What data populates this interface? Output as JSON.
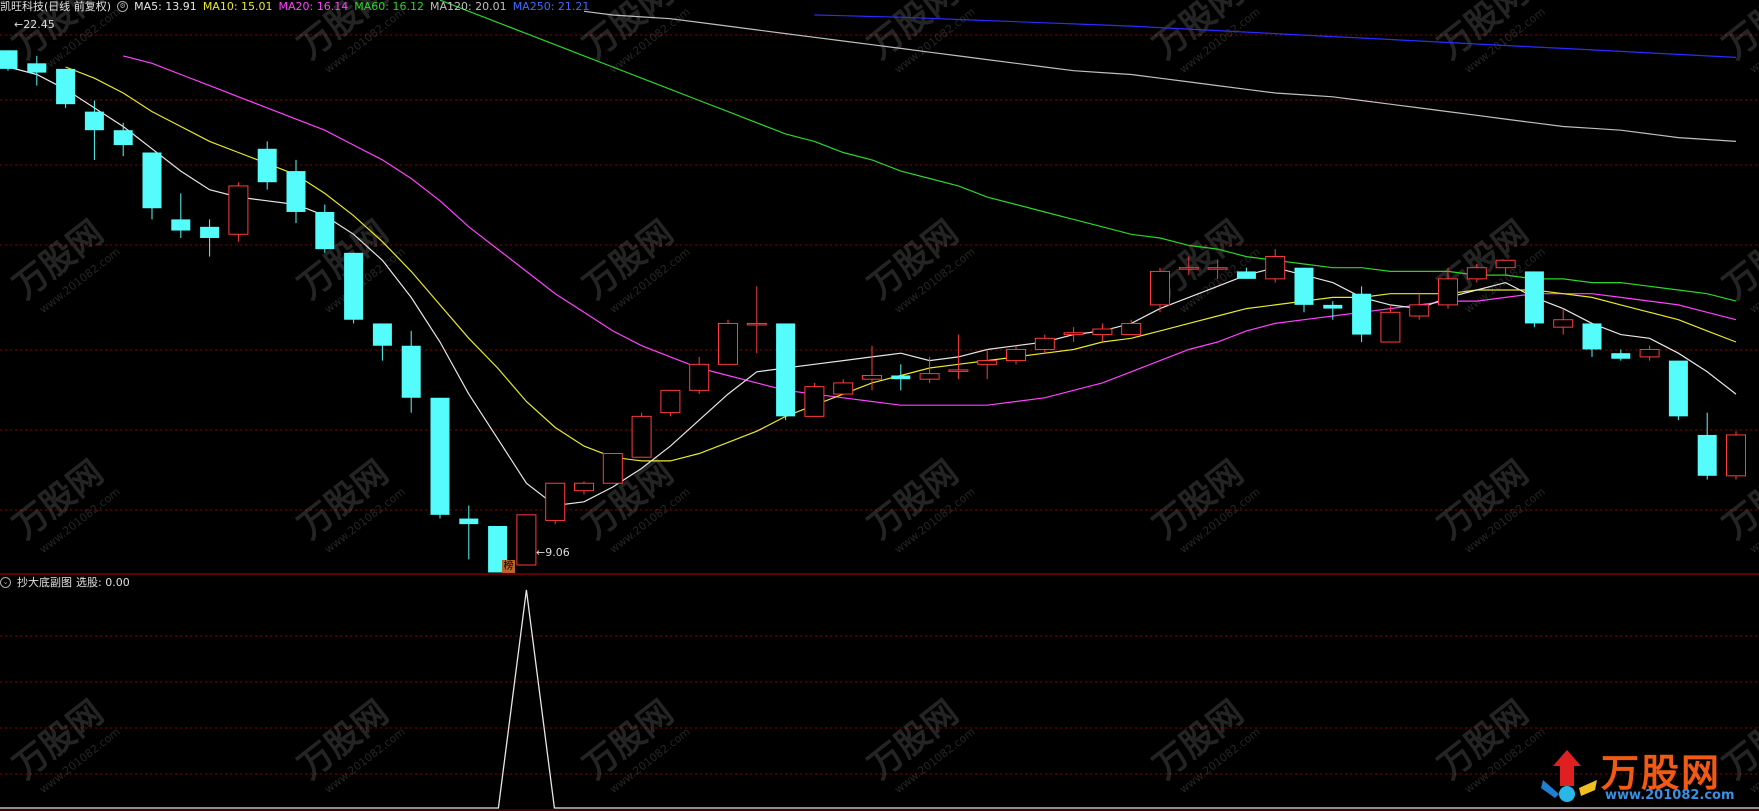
{
  "main_header": {
    "stock_title": "凯旺科技(日线 前复权)",
    "ma5_label": "MA5: 13.91",
    "ma10_label": "MA10: 15.01",
    "ma20_label": "MA20: 16.14",
    "ma60_label": "MA60: 16.12",
    "ma120_label": "MA120: 20.01",
    "ma250_label": "MA250: 21.21"
  },
  "sub_header": {
    "indicator_name": "抄大底副图",
    "pick_label": "选股: 0.00"
  },
  "annotations": {
    "high_price_label": "22.45",
    "low_price_label": "9.06",
    "badge_label": "榜"
  },
  "watermark": {
    "site": "万股网",
    "url": "www.201082.com"
  },
  "colors": {
    "up": "#ff3b3b",
    "down": "#54fcfc",
    "ma5": "#e6e6e6",
    "ma10": "#e8e82a",
    "ma20": "#ff40ff",
    "ma60": "#29d629",
    "ma120": "#bfbfbf",
    "ma250": "#2b2bff",
    "grid": "#8b0000",
    "divider": "#c00000"
  },
  "chart_data": {
    "type": "candlestick",
    "title": "凯旺科技(日线 前复权)",
    "ylim": [
      8.6,
      23.4
    ],
    "candles": [
      {
        "o": 22.45,
        "h": 22.45,
        "l": 21.9,
        "c": 21.95
      },
      {
        "o": 22.1,
        "h": 22.3,
        "l": 21.5,
        "c": 21.85
      },
      {
        "o": 21.95,
        "h": 21.95,
        "l": 20.9,
        "c": 21.0
      },
      {
        "o": 20.8,
        "h": 21.1,
        "l": 19.5,
        "c": 20.3
      },
      {
        "o": 20.3,
        "h": 20.5,
        "l": 19.6,
        "c": 19.9
      },
      {
        "o": 19.7,
        "h": 19.7,
        "l": 17.9,
        "c": 18.2
      },
      {
        "o": 17.9,
        "h": 18.6,
        "l": 17.4,
        "c": 17.6
      },
      {
        "o": 17.7,
        "h": 17.9,
        "l": 16.9,
        "c": 17.4
      },
      {
        "o": 17.5,
        "h": 18.9,
        "l": 17.3,
        "c": 18.8
      },
      {
        "o": 19.8,
        "h": 20.0,
        "l": 18.7,
        "c": 18.9
      },
      {
        "o": 19.2,
        "h": 19.5,
        "l": 17.8,
        "c": 18.1
      },
      {
        "o": 18.1,
        "h": 18.3,
        "l": 17.0,
        "c": 17.1
      },
      {
        "o": 17.0,
        "h": 17.0,
        "l": 15.1,
        "c": 15.2
      },
      {
        "o": 15.1,
        "h": 15.1,
        "l": 14.1,
        "c": 14.5
      },
      {
        "o": 14.5,
        "h": 14.9,
        "l": 12.7,
        "c": 13.1
      },
      {
        "o": 13.1,
        "h": 13.1,
        "l": 9.85,
        "c": 9.95
      },
      {
        "o": 9.85,
        "h": 10.2,
        "l": 8.75,
        "c": 9.7
      },
      {
        "o": 9.65,
        "h": 9.65,
        "l": 8.8,
        "c": 8.4
      },
      {
        "o": 8.6,
        "h": 9.8,
        "l": 9.06,
        "c": 9.95
      },
      {
        "o": 9.8,
        "h": 10.8,
        "l": 9.7,
        "c": 10.8
      },
      {
        "o": 10.6,
        "h": 10.85,
        "l": 10.5,
        "c": 10.8
      },
      {
        "o": 10.8,
        "h": 11.6,
        "l": 10.8,
        "c": 11.6
      },
      {
        "o": 11.5,
        "h": 12.7,
        "l": 11.5,
        "c": 12.6
      },
      {
        "o": 12.7,
        "h": 13.3,
        "l": 12.6,
        "c": 13.3
      },
      {
        "o": 13.3,
        "h": 14.2,
        "l": 13.2,
        "c": 14.0
      },
      {
        "o": 14.0,
        "h": 15.2,
        "l": 14.0,
        "c": 15.1
      },
      {
        "o": 15.1,
        "h": 16.1,
        "l": 14.3,
        "c": 15.1
      },
      {
        "o": 15.1,
        "h": 15.1,
        "l": 12.5,
        "c": 12.6
      },
      {
        "o": 12.6,
        "h": 13.5,
        "l": 12.6,
        "c": 13.4
      },
      {
        "o": 13.2,
        "h": 13.6,
        "l": 13.2,
        "c": 13.5
      },
      {
        "o": 13.6,
        "h": 14.5,
        "l": 13.3,
        "c": 13.7
      },
      {
        "o": 13.7,
        "h": 14.0,
        "l": 13.3,
        "c": 13.6
      },
      {
        "o": 13.6,
        "h": 14.2,
        "l": 13.5,
        "c": 13.75
      },
      {
        "o": 13.85,
        "h": 14.8,
        "l": 13.6,
        "c": 13.85
      },
      {
        "o": 14.0,
        "h": 14.4,
        "l": 13.6,
        "c": 14.1
      },
      {
        "o": 14.1,
        "h": 14.5,
        "l": 14.0,
        "c": 14.4
      },
      {
        "o": 14.4,
        "h": 14.8,
        "l": 14.3,
        "c": 14.7
      },
      {
        "o": 14.8,
        "h": 15.0,
        "l": 14.6,
        "c": 14.85
      },
      {
        "o": 14.8,
        "h": 15.1,
        "l": 14.6,
        "c": 14.95
      },
      {
        "o": 14.8,
        "h": 15.2,
        "l": 14.8,
        "c": 15.1
      },
      {
        "o": 15.6,
        "h": 16.6,
        "l": 15.4,
        "c": 16.5
      },
      {
        "o": 16.6,
        "h": 16.9,
        "l": 16.4,
        "c": 16.6
      },
      {
        "o": 16.6,
        "h": 16.8,
        "l": 16.3,
        "c": 16.6
      },
      {
        "o": 16.5,
        "h": 16.6,
        "l": 16.3,
        "c": 16.3
      },
      {
        "o": 16.3,
        "h": 17.1,
        "l": 16.2,
        "c": 16.9
      },
      {
        "o": 16.6,
        "h": 16.6,
        "l": 15.4,
        "c": 15.6
      },
      {
        "o": 15.6,
        "h": 15.7,
        "l": 15.2,
        "c": 15.5
      },
      {
        "o": 15.9,
        "h": 16.1,
        "l": 14.6,
        "c": 14.8
      },
      {
        "o": 14.6,
        "h": 15.6,
        "l": 14.6,
        "c": 15.4
      },
      {
        "o": 15.3,
        "h": 15.9,
        "l": 15.2,
        "c": 15.6
      },
      {
        "o": 15.6,
        "h": 16.6,
        "l": 15.5,
        "c": 16.3
      },
      {
        "o": 16.3,
        "h": 16.7,
        "l": 16.2,
        "c": 16.6
      },
      {
        "o": 16.6,
        "h": 16.8,
        "l": 16.4,
        "c": 16.8
      },
      {
        "o": 16.5,
        "h": 16.5,
        "l": 15.0,
        "c": 15.1
      },
      {
        "o": 15.0,
        "h": 15.5,
        "l": 14.8,
        "c": 15.2
      },
      {
        "o": 15.1,
        "h": 15.1,
        "l": 14.2,
        "c": 14.4
      },
      {
        "o": 14.3,
        "h": 14.4,
        "l": 14.1,
        "c": 14.15
      },
      {
        "o": 14.2,
        "h": 14.5,
        "l": 14.1,
        "c": 14.4
      },
      {
        "o": 14.1,
        "h": 14.1,
        "l": 12.5,
        "c": 12.6
      },
      {
        "o": 12.1,
        "h": 12.7,
        "l": 10.9,
        "c": 11.0
      },
      {
        "o": 11.0,
        "h": 12.2,
        "l": 10.9,
        "c": 12.1
      }
    ],
    "ma5": [
      22.0,
      21.8,
      21.4,
      20.9,
      20.4,
      19.8,
      19.2,
      18.7,
      18.5,
      18.4,
      18.3,
      18.0,
      17.5,
      16.8,
      15.8,
      14.6,
      13.2,
      12.0,
      10.8,
      10.2,
      10.3,
      10.7,
      11.2,
      11.8,
      12.5,
      13.2,
      13.8,
      13.9,
      14.0,
      14.1,
      14.2,
      14.3,
      14.1,
      14.2,
      14.4,
      14.5,
      14.6,
      14.8,
      14.9,
      15.1,
      15.5,
      15.8,
      16.1,
      16.4,
      16.6,
      16.4,
      16.2,
      15.8,
      15.6,
      15.5,
      15.8,
      16.0,
      16.2,
      15.8,
      15.5,
      15.1,
      14.8,
      14.7,
      14.3,
      13.8,
      13.2
    ],
    "ma10": [
      null,
      null,
      22.0,
      21.7,
      21.3,
      20.8,
      20.4,
      20.0,
      19.7,
      19.4,
      19.1,
      18.6,
      18.0,
      17.3,
      16.5,
      15.6,
      14.7,
      13.9,
      13.0,
      12.3,
      11.8,
      11.5,
      11.4,
      11.4,
      11.6,
      11.9,
      12.2,
      12.6,
      12.9,
      13.2,
      13.5,
      13.7,
      13.9,
      14.0,
      14.1,
      14.2,
      14.3,
      14.4,
      14.6,
      14.7,
      14.9,
      15.1,
      15.3,
      15.5,
      15.6,
      15.7,
      15.8,
      15.8,
      15.9,
      15.9,
      15.9,
      16.0,
      16.0,
      16.0,
      15.9,
      15.8,
      15.6,
      15.4,
      15.2,
      14.9,
      14.6
    ],
    "ma20": [
      null,
      null,
      null,
      null,
      22.3,
      22.1,
      21.8,
      21.5,
      21.2,
      20.9,
      20.6,
      20.3,
      19.9,
      19.5,
      19.0,
      18.4,
      17.7,
      17.1,
      16.5,
      15.9,
      15.4,
      14.9,
      14.5,
      14.2,
      13.9,
      13.7,
      13.5,
      13.3,
      13.2,
      13.1,
      13.0,
      12.9,
      12.9,
      12.9,
      12.9,
      13.0,
      13.1,
      13.3,
      13.5,
      13.8,
      14.1,
      14.4,
      14.6,
      14.9,
      15.1,
      15.2,
      15.3,
      15.4,
      15.5,
      15.6,
      15.7,
      15.7,
      15.8,
      15.9,
      15.9,
      15.9,
      15.8,
      15.7,
      15.6,
      15.4,
      15.2
    ],
    "ma60": [
      null,
      null,
      null,
      null,
      null,
      null,
      null,
      null,
      null,
      null,
      null,
      null,
      null,
      null,
      null,
      23.8,
      23.5,
      23.2,
      22.9,
      22.6,
      22.3,
      22.0,
      21.7,
      21.4,
      21.1,
      20.8,
      20.5,
      20.2,
      20.0,
      19.7,
      19.5,
      19.2,
      19.0,
      18.8,
      18.5,
      18.3,
      18.1,
      17.9,
      17.7,
      17.5,
      17.4,
      17.2,
      17.1,
      16.9,
      16.8,
      16.7,
      16.6,
      16.6,
      16.5,
      16.5,
      16.5,
      16.4,
      16.4,
      16.3,
      16.3,
      16.2,
      16.2,
      16.1,
      16.0,
      15.9,
      15.7
    ],
    "ma120": [
      null,
      null,
      null,
      null,
      null,
      null,
      null,
      null,
      null,
      null,
      null,
      null,
      null,
      null,
      null,
      null,
      null,
      null,
      null,
      null,
      23.5,
      23.4,
      23.35,
      23.3,
      23.2,
      23.1,
      23.0,
      22.9,
      22.8,
      22.7,
      22.6,
      22.5,
      22.4,
      22.3,
      22.2,
      22.1,
      22.0,
      21.9,
      21.85,
      21.8,
      21.7,
      21.6,
      21.5,
      21.4,
      21.3,
      21.25,
      21.2,
      21.1,
      21.0,
      20.9,
      20.8,
      20.7,
      20.6,
      20.5,
      20.4,
      20.35,
      20.3,
      20.2,
      20.1,
      20.05,
      20.0
    ],
    "ma250": [
      null,
      null,
      null,
      null,
      null,
      null,
      null,
      null,
      null,
      null,
      null,
      null,
      null,
      null,
      null,
      null,
      null,
      null,
      null,
      null,
      null,
      null,
      null,
      null,
      null,
      null,
      null,
      null,
      23.4,
      23.38,
      23.36,
      23.34,
      23.31,
      23.28,
      23.25,
      23.22,
      23.19,
      23.16,
      23.13,
      23.1,
      23.06,
      23.02,
      22.98,
      22.94,
      22.9,
      22.86,
      22.82,
      22.78,
      22.74,
      22.7,
      22.66,
      22.62,
      22.58,
      22.54,
      22.5,
      22.46,
      22.42,
      22.38,
      22.34,
      22.3,
      22.26
    ],
    "sub_indicator": {
      "name": "抄大底副图",
      "values_peak_index": 18,
      "ylim": [
        0,
        1
      ]
    }
  }
}
